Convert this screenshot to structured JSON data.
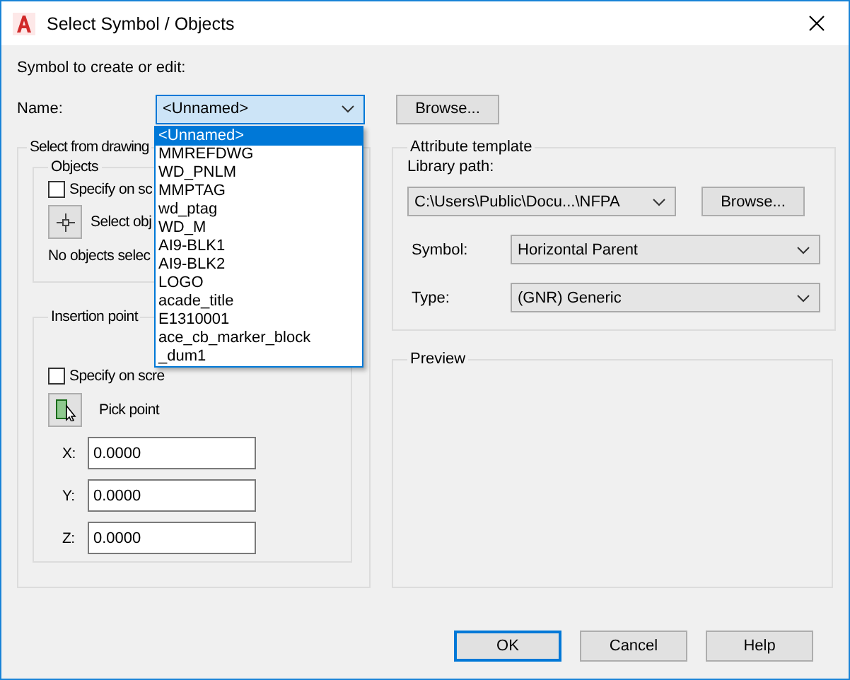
{
  "window": {
    "title": "Select Symbol / Objects"
  },
  "symbol": {
    "heading": "Symbol to create or edit:",
    "name_label": "Name:",
    "name_value": "<Unnamed>",
    "expanded": true,
    "browse": "Browse..."
  },
  "name_options": [
    {
      "label": "<Unnamed>",
      "selected": true
    },
    {
      "label": "MMREFDWG",
      "selected": false
    },
    {
      "label": "WD_PNLM",
      "selected": false
    },
    {
      "label": "MMPTAG",
      "selected": false
    },
    {
      "label": "wd_ptag",
      "selected": false
    },
    {
      "label": "WD_M",
      "selected": false
    },
    {
      "label": "AI9-BLK1",
      "selected": false
    },
    {
      "label": "AI9-BLK2",
      "selected": false
    },
    {
      "label": "LOGO",
      "selected": false
    },
    {
      "label": "acade_title",
      "selected": false
    },
    {
      "label": "E1310001",
      "selected": false
    },
    {
      "label": "ace_cb_marker_block",
      "selected": false
    },
    {
      "label": "_dum1",
      "selected": false
    }
  ],
  "select_from_drawing": {
    "title": "Select from drawing",
    "objects": {
      "title": "Objects",
      "specify": {
        "label": "Specify on sc",
        "checked": false
      },
      "select_label": "Select obj",
      "status": "No objects selec"
    },
    "insertion_point": {
      "title": "Insertion point",
      "specify": {
        "label": "Specify on scre",
        "checked": false
      },
      "pick_label": "Pick point",
      "coords": [
        {
          "label": "X:",
          "value": "0.0000"
        },
        {
          "label": "Y:",
          "value": "0.0000"
        },
        {
          "label": "Z:",
          "value": "0.0000"
        }
      ]
    }
  },
  "attribute_template": {
    "title": "Attribute template",
    "library_label": "Library path:",
    "library_value": "C:\\Users\\Public\\Docu...\\NFPA",
    "browse": "Browse...",
    "symbol_label": "Symbol:",
    "symbol_value": "Horizontal Parent",
    "type_label": "Type:",
    "type_value": "(GNR) Generic"
  },
  "preview": {
    "title": "Preview"
  },
  "buttons": [
    {
      "label": "OK",
      "default": true
    },
    {
      "label": "Cancel",
      "default": false
    },
    {
      "label": "Help",
      "default": false
    }
  ]
}
